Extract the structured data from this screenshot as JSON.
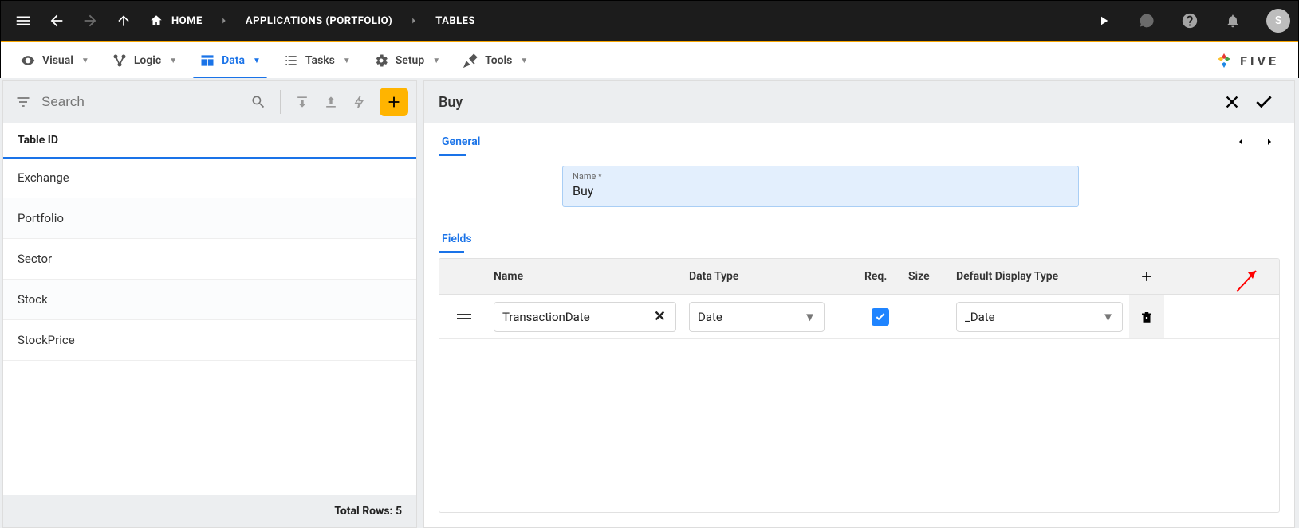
{
  "topbar": {
    "home": "HOME",
    "crumb1": "APPLICATIONS (PORTFOLIO)",
    "crumb2": "TABLES",
    "avatar": "S"
  },
  "tabs": {
    "visual": "Visual",
    "logic": "Logic",
    "data": "Data",
    "tasks": "Tasks",
    "setup": "Setup",
    "tools": "Tools"
  },
  "brand": {
    "text": "FIVE"
  },
  "left": {
    "search_placeholder": "Search",
    "header": "Table ID",
    "rows": [
      {
        "label": "Exchange"
      },
      {
        "label": "Portfolio"
      },
      {
        "label": "Sector"
      },
      {
        "label": "Stock"
      },
      {
        "label": "StockPrice"
      }
    ],
    "footer": "Total Rows: 5"
  },
  "right": {
    "title": "Buy",
    "general_tab": "General",
    "name_label": "Name *",
    "name_value": "Buy",
    "fields_tab": "Fields",
    "columns": {
      "name": "Name",
      "datatype": "Data Type",
      "req": "Req.",
      "size": "Size",
      "ddt": "Default Display Type"
    },
    "field_rows": [
      {
        "name": "TransactionDate",
        "datatype": "Date",
        "req": true,
        "size": "",
        "ddt": "_Date"
      }
    ]
  }
}
